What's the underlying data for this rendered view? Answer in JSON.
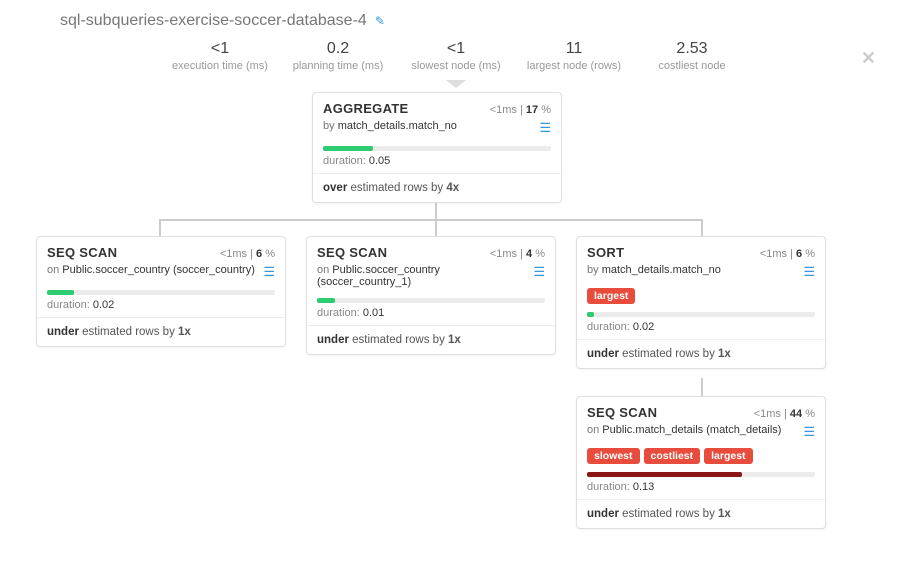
{
  "title": "sql-subqueries-exercise-soccer-database-4",
  "summary": {
    "exec_time": "<1",
    "exec_time_label": "execution time (ms)",
    "plan_time": "0.2",
    "plan_time_label": "planning time (ms)",
    "slowest": "<1",
    "slowest_label": "slowest node (ms)",
    "largest": "11",
    "largest_label": "largest node (rows)",
    "costliest": "2.53",
    "costliest_label": "costliest node"
  },
  "nodes": {
    "agg": {
      "type": "AGGREGATE",
      "time": "<1ms",
      "pct": "17",
      "sub_prefix": "by ",
      "sub_val": "match_details.match_no",
      "bar_width": "22%",
      "bar_class": "bar-green",
      "duration": "0.05",
      "est_kind": "over",
      "est_mid": " estimated rows by ",
      "est_factor": "4x"
    },
    "seq1": {
      "type": "SEQ SCAN",
      "time": "<1ms",
      "pct": "6",
      "sub_prefix": "on ",
      "sub_val": "Public.soccer_country (soccer_country)",
      "bar_width": "12%",
      "bar_class": "bar-green",
      "duration": "0.02",
      "est_kind": "under",
      "est_mid": " estimated rows by ",
      "est_factor": "1x"
    },
    "seq2": {
      "type": "SEQ SCAN",
      "time": "<1ms",
      "pct": "4",
      "sub_prefix": "on ",
      "sub_val": "Public.soccer_country (soccer_country_1)",
      "bar_width": "8%",
      "bar_class": "bar-green",
      "duration": "0.01",
      "est_kind": "under",
      "est_mid": " estimated rows by ",
      "est_factor": "1x"
    },
    "sort": {
      "type": "SORT",
      "time": "<1ms",
      "pct": "6",
      "sub_prefix": "by ",
      "sub_val": "match_details.match_no",
      "badges": [
        "largest"
      ],
      "bar_width": "3%",
      "bar_class": "bar-green",
      "duration": "0.02",
      "est_kind": "under",
      "est_mid": " estimated rows by ",
      "est_factor": "1x"
    },
    "seq3": {
      "type": "SEQ SCAN",
      "time": "<1ms",
      "pct": "44",
      "sub_prefix": "on ",
      "sub_val": "Public.match_details (match_details)",
      "badges": [
        "slowest",
        "costliest",
        "largest"
      ],
      "bar_width": "68%",
      "bar_class": "bar-red",
      "duration": "0.13",
      "est_kind": "under",
      "est_mid": " estimated rows by ",
      "est_factor": "1x"
    }
  },
  "labels": {
    "duration_prefix": "duration: ",
    "percent_suffix": " %",
    "pipe": " | "
  }
}
